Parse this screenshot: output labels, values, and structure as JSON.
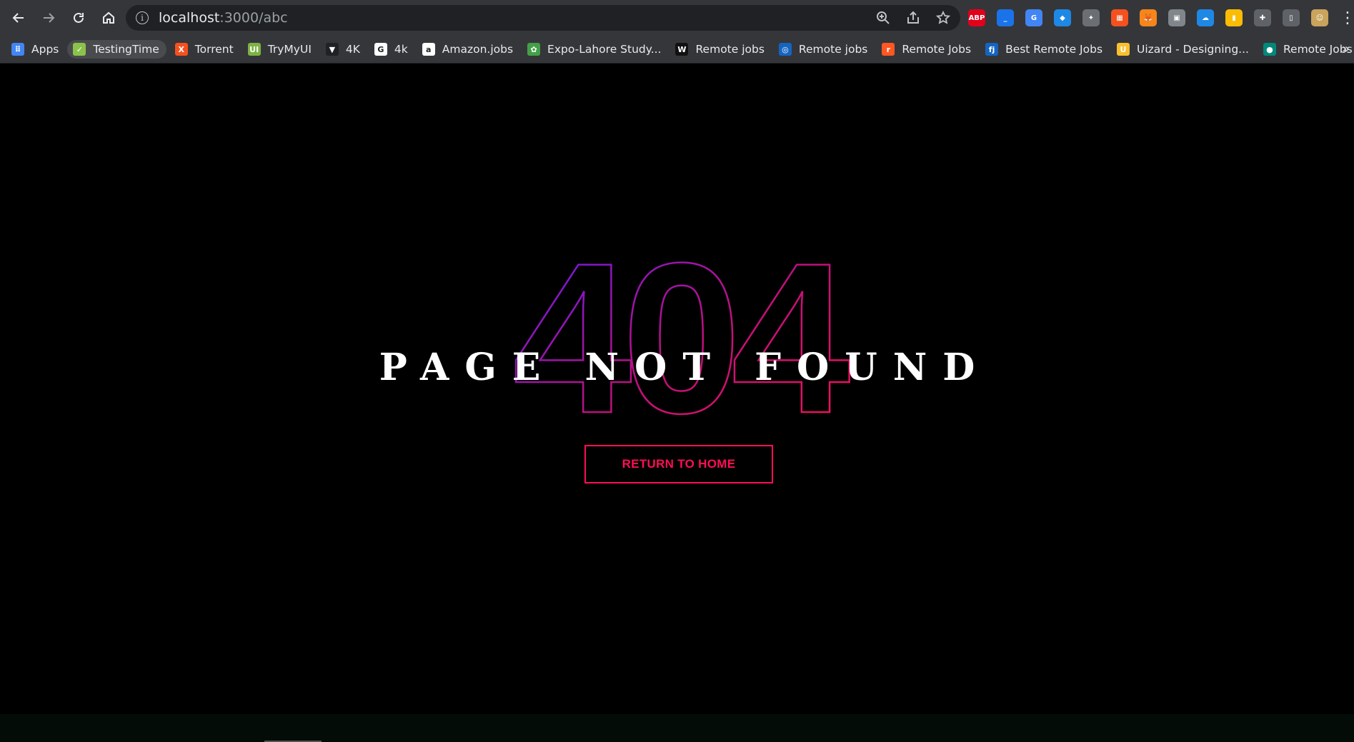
{
  "browser": {
    "url_host": "localhost",
    "url_path": ":3000/abc",
    "back_icon": "arrow-left-icon",
    "forward_icon": "arrow-right-icon",
    "reload_icon": "reload-icon",
    "home_icon": "home-icon",
    "extensions": [
      {
        "name": "abp-icon",
        "label": "ABP",
        "color": "#e2001a"
      },
      {
        "name": "extension-underline-icon",
        "label": "_",
        "color": "#1a73e8"
      },
      {
        "name": "google-translate-icon",
        "label": "G",
        "color": "#4285f4"
      },
      {
        "name": "gem-icon",
        "label": "◆",
        "color": "#1e88e5"
      },
      {
        "name": "eagle-icon",
        "label": "✦",
        "color": "#6b6f73"
      },
      {
        "name": "colorful-extension-icon",
        "label": "▦",
        "color": "#f4511e"
      },
      {
        "name": "metamask-icon",
        "label": "🦊",
        "color": "#f6851b"
      },
      {
        "name": "gray-extension-icon",
        "label": "▣",
        "color": "#80868b"
      },
      {
        "name": "cloud-icon",
        "label": "☁",
        "color": "#1e88e5"
      },
      {
        "name": "bookmark-yellow-icon",
        "label": "▮",
        "color": "#fbbc04"
      },
      {
        "name": "puzzle-icon",
        "label": "✚",
        "color": "#5f6368"
      },
      {
        "name": "sidepanel-icon",
        "label": "▯",
        "color": "#5f6368"
      },
      {
        "name": "profile-avatar-icon",
        "label": "☺",
        "color": "#c9a45c"
      }
    ]
  },
  "bookmarks": [
    {
      "label": "Apps",
      "icon": "apps-grid-icon",
      "icon_color": "#4285f4",
      "glyph": "⠿"
    },
    {
      "label": "TestingTime",
      "icon": "testingtime-icon",
      "icon_color": "#8bc34a",
      "glyph": "✓",
      "active": true
    },
    {
      "label": "Torrent",
      "icon": "torrent-x-icon",
      "icon_color": "#f4511e",
      "glyph": "X"
    },
    {
      "label": "TryMyUI",
      "icon": "trymyui-icon",
      "icon_color": "#7cb342",
      "glyph": "UI"
    },
    {
      "label": "4K",
      "icon": "4k-triangle-icon",
      "icon_color": "#202124",
      "glyph": "▼"
    },
    {
      "label": "4k",
      "icon": "google-icon",
      "icon_color": "#ffffff",
      "glyph": "G"
    },
    {
      "label": "Amazon.jobs",
      "icon": "amazon-icon",
      "icon_color": "#ffffff",
      "glyph": "a"
    },
    {
      "label": "Expo-Lahore Study...",
      "icon": "expo-icon",
      "icon_color": "#43a047",
      "glyph": "✿"
    },
    {
      "label": "Remote jobs",
      "icon": "wwr-icon",
      "icon_color": "#111111",
      "glyph": "W"
    },
    {
      "label": "Remote jobs",
      "icon": "remote-globe-icon",
      "icon_color": "#1565c0",
      "glyph": "◎"
    },
    {
      "label": "Remote Jobs",
      "icon": "remote-orange-icon",
      "icon_color": "#ff5722",
      "glyph": "r"
    },
    {
      "label": "Best Remote Jobs",
      "icon": "fj-icon",
      "icon_color": "#1565c0",
      "glyph": "fj"
    },
    {
      "label": "Uizard - Designing...",
      "icon": "uizard-icon",
      "icon_color": "#fbc02d",
      "glyph": "U"
    },
    {
      "label": "Remote Jobs | Work...",
      "icon": "remote-teal-icon",
      "icon_color": "#00897b",
      "glyph": "●"
    }
  ],
  "bookmarks_more": "»",
  "page": {
    "code": "404",
    "title": "PAGE NOT FOUND",
    "button": "RETURN TO HOME",
    "accent": "#ff0e55",
    "outline_violet": "#7b1fff"
  }
}
